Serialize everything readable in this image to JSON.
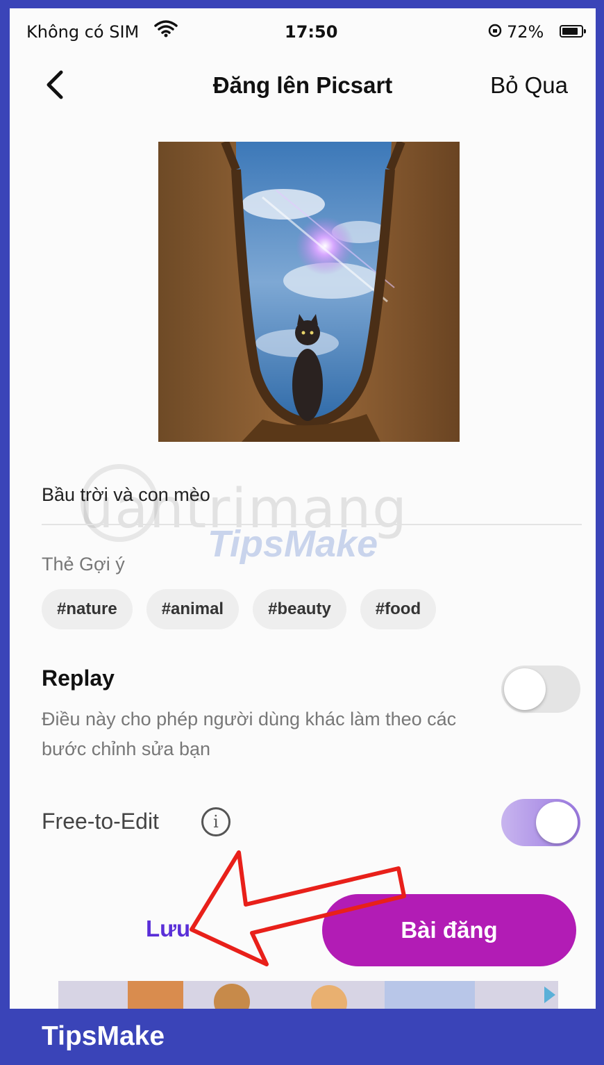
{
  "status_bar": {
    "carrier": "Không có SIM",
    "time": "17:50",
    "battery_percent": "72%"
  },
  "nav": {
    "back_icon": "chevron-left-icon",
    "title": "Đăng lên Picsart",
    "skip_label": "Bỏ Qua"
  },
  "photo": {
    "alt": "cat sitting in archway under sky"
  },
  "caption": "Bầu trời và con mèo",
  "watermarks": {
    "quantrimang": "uantrimang",
    "tipsmake": "TipsMake"
  },
  "tags": {
    "label": "Thẻ Gợi ý",
    "items": [
      "#nature",
      "#animal",
      "#beauty",
      "#food"
    ]
  },
  "replay": {
    "title": "Replay",
    "description": "Điều này cho phép người dùng khác làm theo các bước chỉnh sửa bạn",
    "enabled": false
  },
  "free_to_edit": {
    "label": "Free-to-Edit",
    "info_icon": "i",
    "enabled": true
  },
  "actions": {
    "save_label": "Lưu",
    "post_label": "Bài đăng"
  },
  "colors": {
    "accent_post": "#b21cb5",
    "save_text": "#5a2fd8",
    "toggle_on": "#9a78e0",
    "frame_border": "#3a44b8",
    "annotation_arrow": "#e8201a"
  },
  "footer": {
    "brand": "TipsMake"
  }
}
